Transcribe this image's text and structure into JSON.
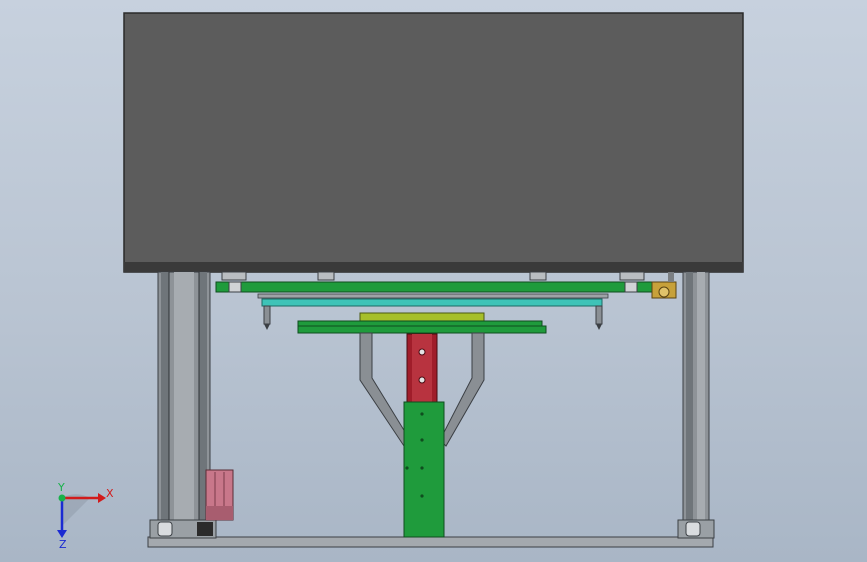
{
  "view": {
    "background_colors": [
      "#c7d1de",
      "#a9b6c6"
    ],
    "model_colors": {
      "housing": "#5c5c5c",
      "frame": "#9ea3a7",
      "green_part": "#1f9b3c",
      "cyan_plate": "#3ec3b7",
      "yellow_block": "#a6bf2a",
      "red_block": "#a01d2a",
      "pink_motor": "#c8778a",
      "brass_fitting": "#c7a13a"
    }
  },
  "triad": {
    "x_label": "X",
    "y_label": "Y",
    "z_label": "Z",
    "x_color": "#d21b1b",
    "y_color": "#18b14a",
    "z_color": "#1b2bd2"
  }
}
